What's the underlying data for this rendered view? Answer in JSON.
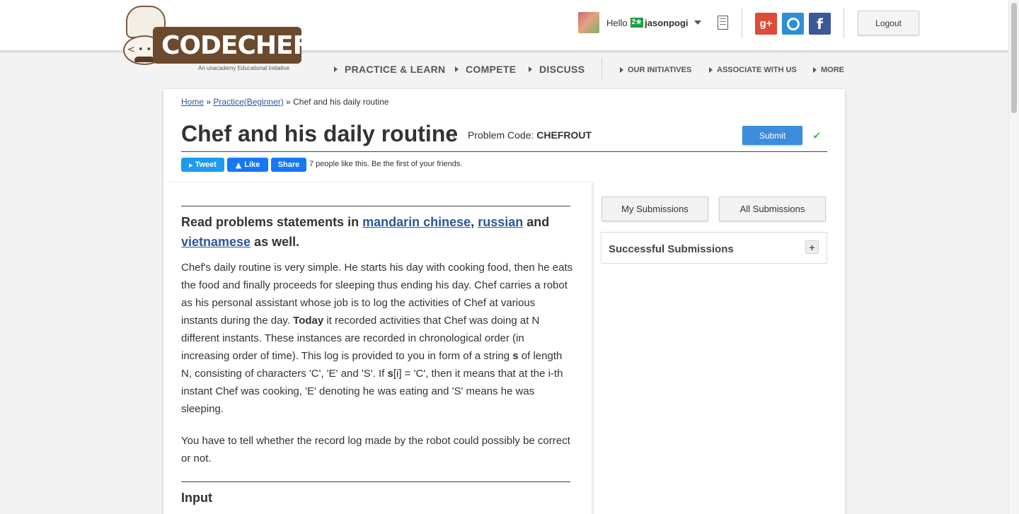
{
  "header": {
    "logo": {
      "wordmark": "CODECHEF",
      "tagline": "An unacademy Educational Initiative"
    },
    "user": {
      "greeting": "Hello",
      "rating_badge": "2★",
      "username": "jasonpogi"
    },
    "social": {
      "gplus_label": "g+",
      "facebook_label": "f"
    },
    "logout_label": "Logout"
  },
  "nav": {
    "main": [
      "PRACTICE & LEARN",
      "COMPETE",
      "DISCUSS"
    ],
    "secondary": [
      "OUR INITIATIVES",
      "ASSOCIATE WITH US",
      "MORE"
    ]
  },
  "breadcrumb": {
    "home": "Home",
    "sep1": "»",
    "practice": "Practice(Beginner)",
    "sep2": "»",
    "current": "Chef and his daily routine"
  },
  "problem": {
    "title": "Chef and his daily routine",
    "code_label": "Problem Code:",
    "code": "CHEFROUT",
    "submit_label": "Submit"
  },
  "share": {
    "tweet_label": "Tweet",
    "like_label": "Like",
    "share_label": "Share",
    "likes_text": "7 people like this. Be the first of your friends."
  },
  "statement": {
    "lang_prefix": "Read problems statements in",
    "lang1": "mandarin chinese",
    "comma": ",",
    "lang2": "russian",
    "and": "and",
    "lang3": "vietnamese",
    "lang_suffix": "as well.",
    "p1_a": "Chef's daily routine is very simple. He starts his day with cooking food, then he eats the food and finally proceeds for sleeping thus ending his day. Chef carries a robot as his personal assistant whose job is to log the activities of Chef at various instants during the day.",
    "p1_today": "Today",
    "p1_b": "it recorded activities that Chef was doing at N different instants. These instances are recorded in chronological order (in increasing order of time). This log is provided to you in form of a string",
    "p1_s1": "s",
    "p1_c": "of length N, consisting of characters 'C', 'E' and 'S'. If",
    "p1_s2": "s",
    "p1_d": "[i] = 'C', then it means that at the i-th instant Chef was cooking, 'E' denoting he was eating and 'S' means he was sleeping.",
    "p2": "You have to tell whether the record log made by the robot could possibly be correct or not.",
    "input_heading": "Input"
  },
  "sidebar": {
    "my_submissions": "My Submissions",
    "all_submissions": "All Submissions",
    "successful_submissions": "Successful Submissions",
    "expand_label": "+"
  }
}
